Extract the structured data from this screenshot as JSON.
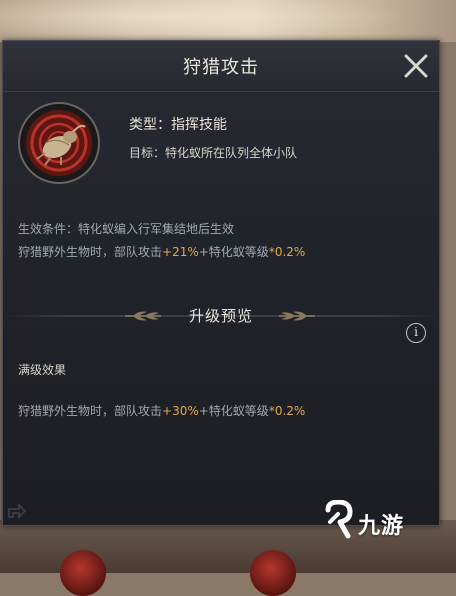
{
  "dialog": {
    "title": "狩猎攻击",
    "close_icon": "close-icon"
  },
  "skill": {
    "icon": "beetle-skill-icon",
    "type_label": "类型：",
    "type_value": "指挥技能",
    "target_label": "目标：",
    "target_value": "特化蚁所在队列全体小队"
  },
  "current": {
    "condition": "生效条件：特化蚁编入行军集结地后生效",
    "effect_prefix": "狩猎野外生物时，部队攻击",
    "effect_value": "+21%",
    "effect_mid": "+特化蚁等级",
    "effect_mult": "*0.2%"
  },
  "upgrade": {
    "title": "升级预览",
    "info_symbol": "i",
    "max_label": "满级效果",
    "effect_prefix": "狩猎野外生物时，部队攻击",
    "effect_value": "+30%",
    "effect_mid": "+特化蚁等级",
    "effect_mult": "*0.2%"
  },
  "watermark": {
    "text": "九游"
  },
  "colors": {
    "highlight": "#e0a850",
    "text_primary": "#e9e4da",
    "text_secondary": "#a3a7ae",
    "panel": "#1f2228"
  }
}
